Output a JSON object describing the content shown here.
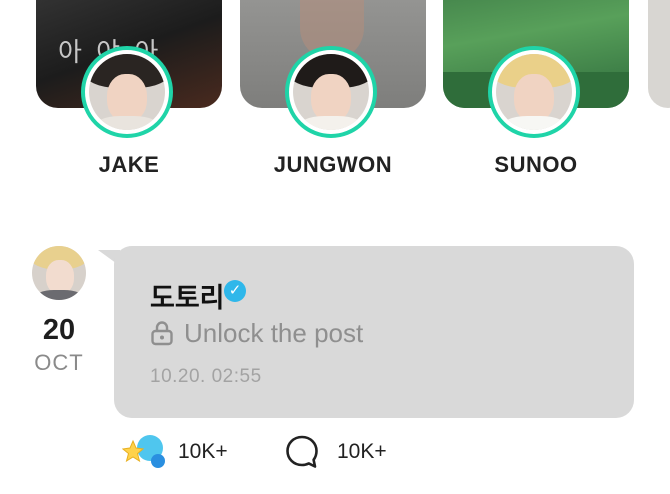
{
  "stories": [
    {
      "name": "JAKE",
      "thumb_style": "dark",
      "thumb_text": "아 야 아",
      "hair_color": "#2a2522",
      "shirt_color": "#e9e4de"
    },
    {
      "name": "JUNGWON",
      "thumb_style": "gray",
      "thumb_text": "",
      "hair_color": "#1f1b19",
      "shirt_color": "#f4f1ec"
    },
    {
      "name": "SUNOO",
      "thumb_style": "green",
      "thumb_text": "",
      "hair_color": "#ead089",
      "shirt_color": "#f7f7f4"
    }
  ],
  "story_ring_color": "#1fd4a8",
  "post": {
    "date_day": "20",
    "date_month": "OCT",
    "author": "도토리",
    "verified_icon": "verified-check-icon",
    "lock_icon": "lock-icon",
    "locked_text": "Unlock the post",
    "timestamp": "10.20. 02:55",
    "bubble_color": "#d9d9d9",
    "accent_color": "#2fb7ea"
  },
  "reactions": {
    "like_icon": "star-sparkle-icon",
    "like_count": "10K+",
    "comment_icon": "comment-bubble-icon",
    "comment_count": "10K+"
  }
}
